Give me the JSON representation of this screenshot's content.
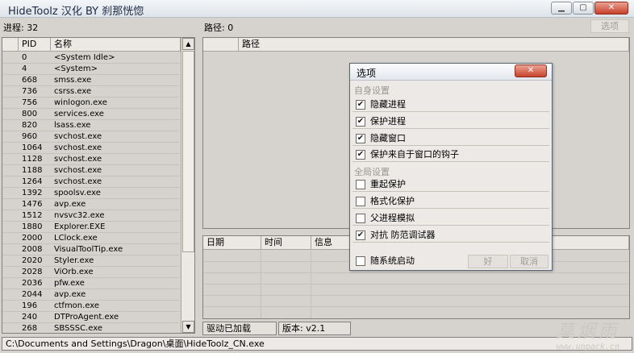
{
  "window": {
    "title": "HideToolz 汉化 BY 刹那恍惚",
    "min_label": "▁",
    "max_label": "▢",
    "close_label": "✕"
  },
  "process_count": "进程: 32",
  "path_count": "路径: 0",
  "options_button": "选项",
  "process_table": {
    "headers": [
      "PID",
      "名称"
    ],
    "rows": [
      [
        "0",
        "<System Idle>"
      ],
      [
        "4",
        "<System>"
      ],
      [
        "668",
        "smss.exe"
      ],
      [
        "736",
        "csrss.exe"
      ],
      [
        "756",
        "winlogon.exe"
      ],
      [
        "800",
        "services.exe"
      ],
      [
        "820",
        "lsass.exe"
      ],
      [
        "960",
        "svchost.exe"
      ],
      [
        "1064",
        "svchost.exe"
      ],
      [
        "1128",
        "svchost.exe"
      ],
      [
        "1188",
        "svchost.exe"
      ],
      [
        "1264",
        "svchost.exe"
      ],
      [
        "1392",
        "spoolsv.exe"
      ],
      [
        "1476",
        "avp.exe"
      ],
      [
        "1512",
        "nvsvc32.exe"
      ],
      [
        "1880",
        "Explorer.EXE"
      ],
      [
        "2000",
        "LClock.exe"
      ],
      [
        "2008",
        "VisualToolTip.exe"
      ],
      [
        "2020",
        "Styler.exe"
      ],
      [
        "2028",
        "ViOrb.exe"
      ],
      [
        "2036",
        "pfw.exe"
      ],
      [
        "2044",
        "avp.exe"
      ],
      [
        "196",
        "ctfmon.exe"
      ],
      [
        "240",
        "DTProAgent.exe"
      ],
      [
        "268",
        "SBSSSC.exe"
      ]
    ]
  },
  "path_table": {
    "header": "路径"
  },
  "log_table": {
    "headers": [
      "日期",
      "时间",
      "信息"
    ]
  },
  "status": {
    "driver": "驱动已加载",
    "version": "版本: v2.1",
    "path": "C:\\Documents and Settings\\Dragon\\桌面\\HideToolz_CN.exe"
  },
  "dialog": {
    "title": "选项",
    "close_label": "✕",
    "group_self": "自身设置",
    "group_global": "全局设置",
    "options_self": [
      {
        "label": "隐藏进程",
        "checked": true
      },
      {
        "label": "保护进程",
        "checked": true
      },
      {
        "label": "隐藏窗口",
        "checked": true
      },
      {
        "label": "保护来自于窗口的钩子",
        "checked": true
      }
    ],
    "options_global": [
      {
        "label": "重起保护",
        "checked": false
      },
      {
        "label": "格式化保护",
        "checked": false
      },
      {
        "label": "父进程模拟",
        "checked": false
      },
      {
        "label": "对抗 防范调试器",
        "checked": true
      }
    ],
    "startup": {
      "label": "随系统启动",
      "checked": false
    },
    "ok": "好",
    "cancel": "取消"
  },
  "watermark": {
    "line1": "莫烟雨",
    "line2": "www.unpack.cn"
  },
  "check_mark": "✔"
}
